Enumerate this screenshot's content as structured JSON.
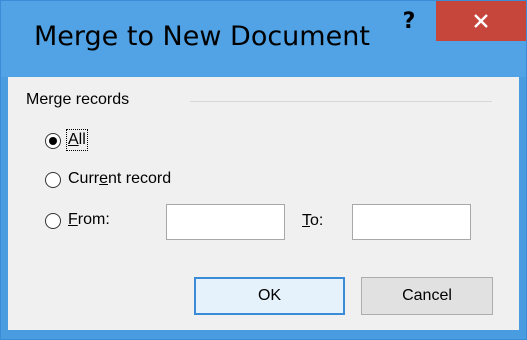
{
  "window": {
    "title": "Merge to New Document",
    "help_label": "?",
    "close_icon": "close-icon"
  },
  "merge_records": {
    "group_label": "Merge records",
    "options": [
      {
        "label_pre": "",
        "label_u": "A",
        "label_post": "ll",
        "selected": true
      },
      {
        "label_pre": "Curr",
        "label_u": "e",
        "label_post": "nt record",
        "selected": false
      },
      {
        "label_pre": "",
        "label_u": "F",
        "label_post": "rom:",
        "selected": false
      }
    ],
    "from_value": "",
    "to_label_u": "T",
    "to_label_post": "o:",
    "to_value": ""
  },
  "buttons": {
    "ok": "OK",
    "cancel": "Cancel"
  },
  "colors": {
    "title_bar": "#51a3e5",
    "close_button": "#c7463b",
    "client_bg": "#f0f0f0"
  }
}
